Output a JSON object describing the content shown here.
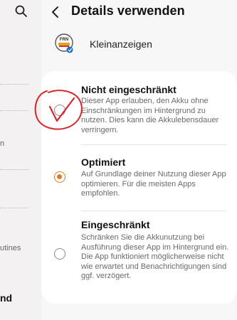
{
  "background_panel": {
    "fragments": [
      "n",
      "utines",
      "nd"
    ]
  },
  "header": {
    "title": "Details verwenden"
  },
  "app": {
    "name": "Kleinanzeigen",
    "icon_badge_text": "FRN"
  },
  "options": [
    {
      "title": "Nicht eingeschränkt",
      "description": "Dieser App erlauben, den Akku ohne Einschränkungen im Hintergrund zu nutzen. Dies kann die Akkulebensdauer verringern.",
      "selected": false
    },
    {
      "title": "Optimiert",
      "description": "Auf Grundlage deiner Nutzung dieser App optimieren. Für die meisten Apps empfohlen.",
      "selected": true
    },
    {
      "title": "Eingeschränkt",
      "description": "Schränken Sie die Akkunutzung bei Ausführung dieser App im Hintergrund ein. Die App funktioniert möglicherweise nicht wie erwartet und Benachrichtigungen sind ggf. verzögert.",
      "selected": false
    }
  ],
  "colors": {
    "accent": "#e07a2b",
    "annotation": "#d9262b"
  }
}
